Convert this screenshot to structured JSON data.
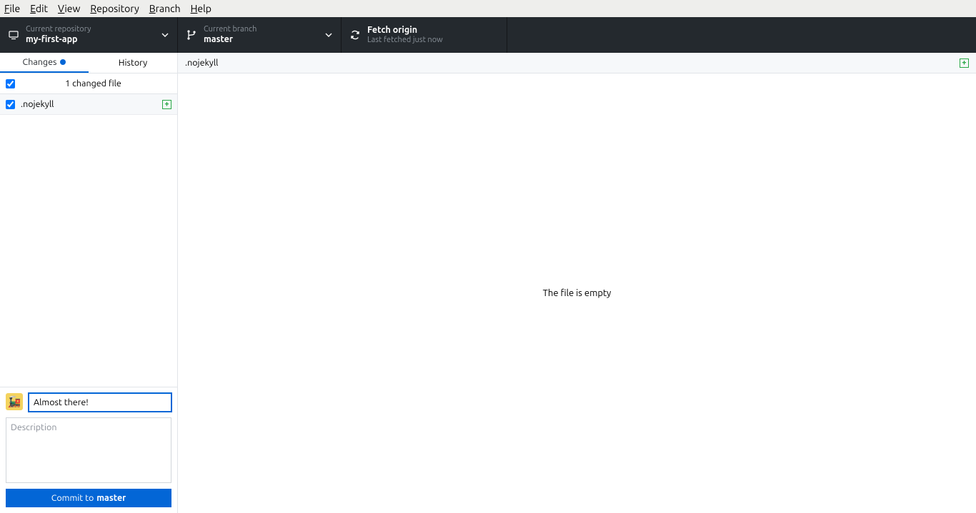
{
  "menubar": {
    "file": "File",
    "edit": "Edit",
    "view": "View",
    "repository": "Repository",
    "branch": "Branch",
    "help": "Help"
  },
  "topbar": {
    "repo": {
      "sub": "Current repository",
      "main": "my-first-app"
    },
    "branch": {
      "sub": "Current branch",
      "main": "master"
    },
    "fetch": {
      "main": "Fetch origin",
      "sub": "Last fetched just now"
    }
  },
  "tabs": {
    "changes": "Changes",
    "history": "History"
  },
  "summary": {
    "text": "1 changed file"
  },
  "files": [
    {
      "name": ".nojekyll"
    }
  ],
  "commit": {
    "summary_value": "Almost there!",
    "desc_placeholder": "Description",
    "button_prefix": "Commit to ",
    "button_branch": "master"
  },
  "diff": {
    "filename": ".nojekyll",
    "empty_msg": "The file is empty"
  }
}
